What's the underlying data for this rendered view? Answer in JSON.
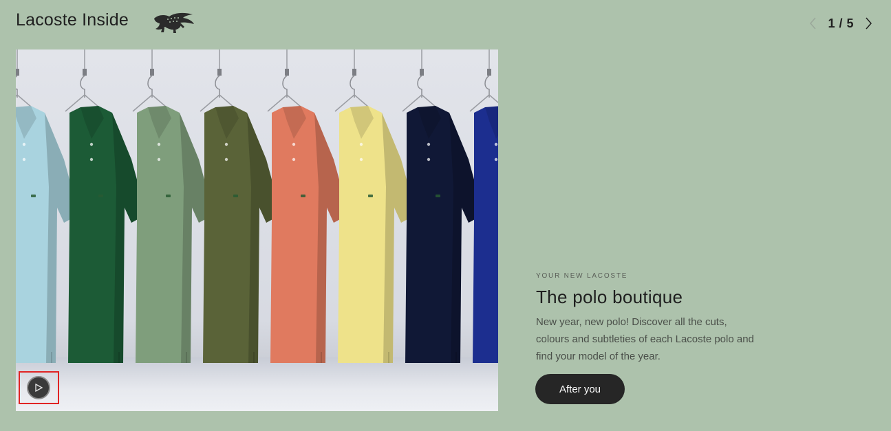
{
  "header": {
    "title": "Lacoste Inside",
    "logo_icon": "crocodile-logo-icon",
    "pager": {
      "current": "1 / 5",
      "prev_icon": "chevron-left-icon",
      "next_icon": "chevron-right-icon"
    }
  },
  "media": {
    "image_subject": "polo-shirts-on-hangers",
    "shirt_colors": [
      "#a9d3df",
      "#1c5b36",
      "#7f9e7c",
      "#5a6338",
      "#e07a5f",
      "#eee28a",
      "#101836",
      "#1c2e8f",
      "#8e9bd6"
    ],
    "play_icon": "play-icon"
  },
  "content": {
    "eyebrow": "YOUR NEW LACOSTE",
    "heading": "The polo boutique",
    "description": "New year, new polo! Discover all the cuts, colours and subtleties of each Lacoste polo and find your model of the year.",
    "cta_label": "After you"
  },
  "colors": {
    "page_background": "#adc2ac",
    "button_background": "#262626",
    "highlight_frame": "#e02424"
  }
}
